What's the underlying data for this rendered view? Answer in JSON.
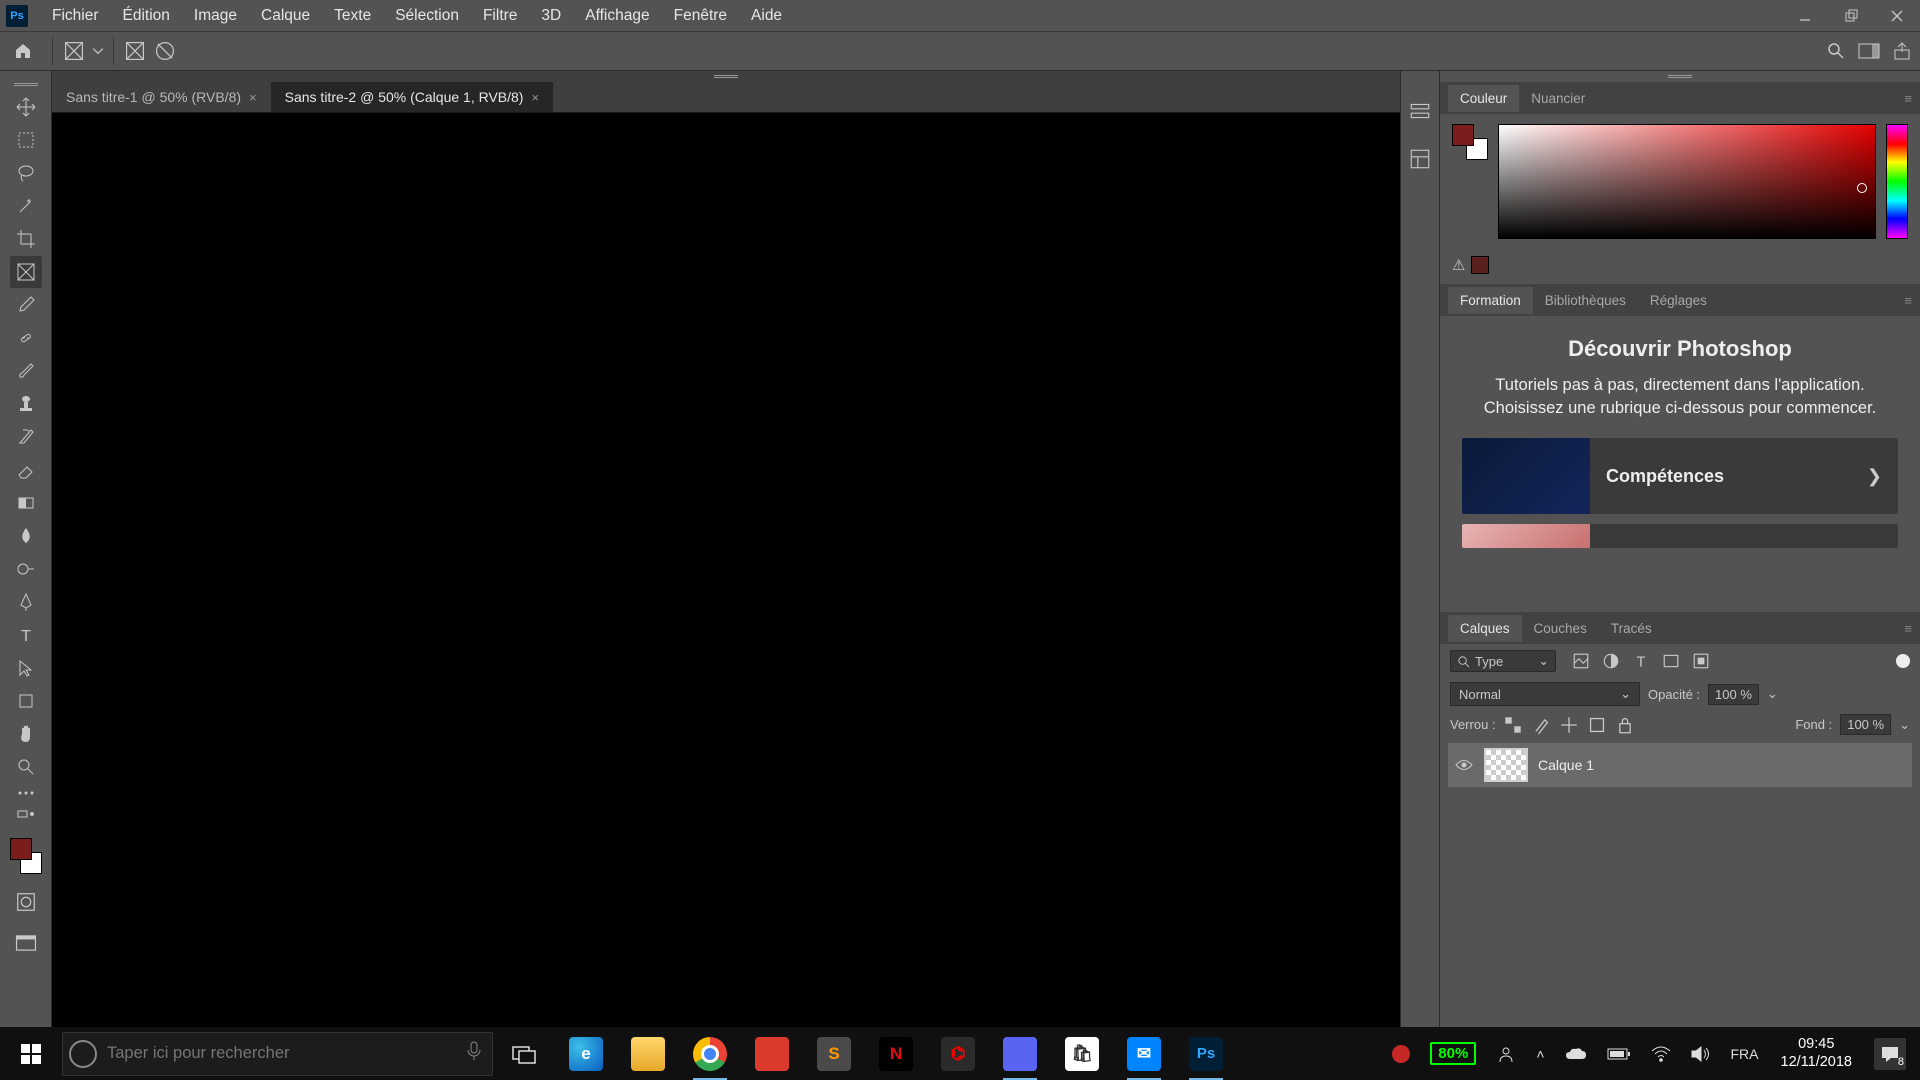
{
  "menu": [
    "Fichier",
    "Édition",
    "Image",
    "Calque",
    "Texte",
    "Sélection",
    "Filtre",
    "3D",
    "Affichage",
    "Fenêtre",
    "Aide"
  ],
  "tabs": [
    {
      "title": "Sans titre-1 @ 50% (RVB/8)",
      "active": false
    },
    {
      "title": "Sans titre-2 @ 50% (Calque 1, RVB/8)",
      "active": true
    }
  ],
  "panels": {
    "color": {
      "tabs": [
        "Couleur",
        "Nuancier"
      ],
      "active": 0
    },
    "learn": {
      "tabs": [
        "Formation",
        "Bibliothèques",
        "Réglages"
      ],
      "active": 0,
      "title": "Découvrir Photoshop",
      "desc": "Tutoriels pas à pas, directement dans l'application. Choisissez une rubrique ci-dessous pour commencer.",
      "card1": "Compétences"
    },
    "layers": {
      "tabs": [
        "Calques",
        "Couches",
        "Tracés"
      ],
      "active": 0,
      "kind": "Type",
      "blend": "Normal",
      "opacity_label": "Opacité :",
      "opacity_val": "100 %",
      "lock_label": "Verrou :",
      "fill_label": "Fond :",
      "fill_val": "100 %",
      "layer1": "Calque 1"
    }
  },
  "taskbar": {
    "search_placeholder": "Taper ici pour rechercher",
    "battery": "80%",
    "lang": "FRA",
    "time": "09:45",
    "date": "12/11/2018",
    "notif_count": "8"
  }
}
